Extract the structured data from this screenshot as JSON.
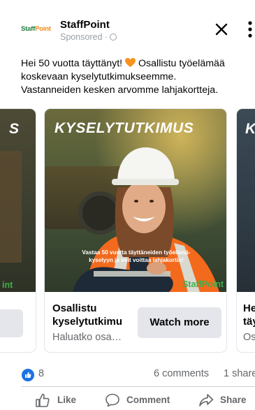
{
  "post": {
    "advertiser": "StaffPoint",
    "sponsored_label": "Sponsored ·",
    "logo_text_a": "Staff",
    "logo_text_b": "Point",
    "message_lines": [
      "Hei 50 vuotta täyttänyt!",
      " Osallistu työelämää",
      "koskevaan kyselytutkimukseemme.",
      "Vastanneiden kesken arvomme lahjakortteja."
    ]
  },
  "carousel": {
    "prev_card": {
      "headline": "S",
      "brand": "int"
    },
    "main_card": {
      "headline": "KYSELYTUTKIMUS",
      "overlay_lines": [
        "Vastaa 50 vuotta täyttäneiden työelämä-",
        "kyselyyn ja voit voittaa lahjakortin!"
      ],
      "brand": "StaffPoint",
      "title_lines": [
        "Osallistu",
        "kyselytutkimu"
      ],
      "description": "Haluatko osa…",
      "cta_label": "Watch more"
    },
    "next_card": {
      "headline": "K",
      "title_lines": [
        "He",
        "täy"
      ],
      "description": "Os"
    }
  },
  "engagement": {
    "like_count": "8",
    "comments": "6 comments",
    "shares": "1 share"
  },
  "actions": {
    "like": "Like",
    "comment": "Comment",
    "share": "Share"
  },
  "colors": {
    "facebook_blue": "#1b74e4",
    "brand_green": "#3fae49",
    "heart_orange": "#f7931e"
  }
}
